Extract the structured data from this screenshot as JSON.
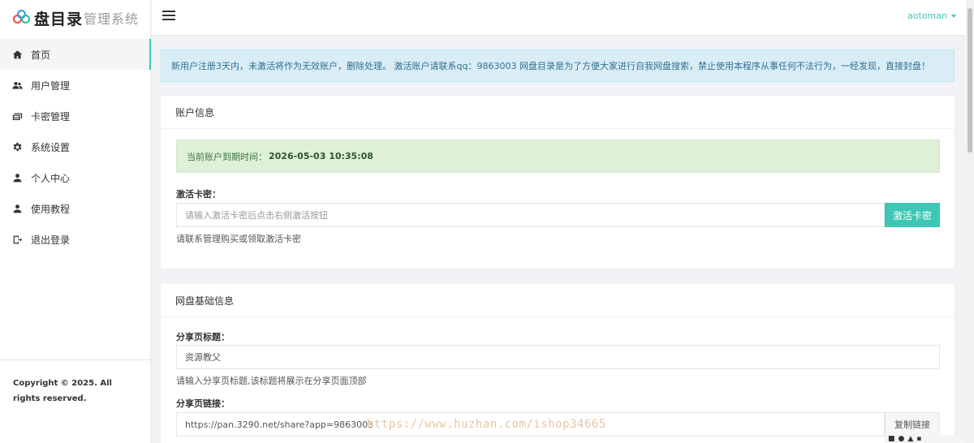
{
  "app": {
    "logo_bold": "盘目录",
    "logo_light": "管理系统"
  },
  "sidebar": {
    "items": [
      {
        "label": "首页",
        "icon": "home-icon",
        "active": true
      },
      {
        "label": "用户管理",
        "icon": "users-icon",
        "active": false
      },
      {
        "label": "卡密管理",
        "icon": "card-icon",
        "active": false
      },
      {
        "label": "系统设置",
        "icon": "gear-icon",
        "active": false
      },
      {
        "label": "个人中心",
        "icon": "user-icon",
        "active": false
      },
      {
        "label": "使用教程",
        "icon": "user-icon",
        "active": false
      },
      {
        "label": "退出登录",
        "icon": "logout-icon",
        "active": false
      }
    ],
    "copyright": "Copyright © 2025. All rights reserved."
  },
  "header": {
    "username": "aotoman"
  },
  "notice": {
    "text": "新用户注册3天内，未激活将作为无效账户，删除处理。 激活账户请联系qq：9863003 网盘目录是为了方便大家进行自我网盘搜索，禁止使用本程序从事任何不法行为，一经发现，直接封盘！"
  },
  "account": {
    "title": "账户信息",
    "expire_label": "当前账户到期时间：",
    "expire_value": "2026-05-03 10:35:08",
    "activate_label": "激活卡密：",
    "activate_placeholder": "请输入激活卡密后点击右侧激活按钮",
    "activate_button": "激活卡密",
    "activate_help": "请联系管理购买或领取激活卡密"
  },
  "pan": {
    "title": "网盘基础信息",
    "share_title_label": "分享页标题：",
    "share_title_value": "资源教父",
    "share_title_help": "请输入分享页标题,该标题将展示在分享页面顶部",
    "share_link_label": "分享页链接：",
    "share_link_value": "https://pan.3290.net/share?app=9863003",
    "copy_button": "复制链接"
  },
  "watermark": "https://www.huzhan.com/ishop34665",
  "colors": {
    "accent": "#3cc8b4",
    "notice_bg": "#d9edf7",
    "success_bg": "#dff0d8"
  }
}
